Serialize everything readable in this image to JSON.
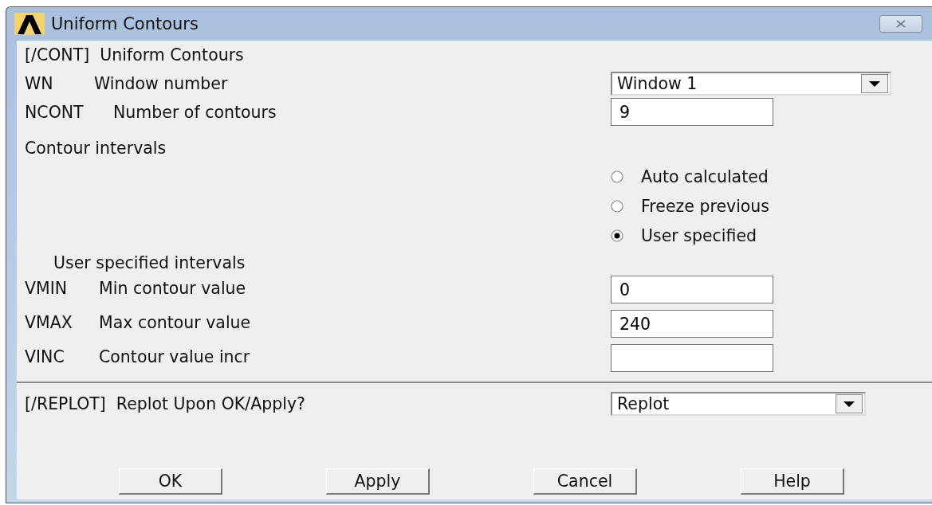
{
  "window": {
    "title": "Uniform Contours"
  },
  "heading": "[/CONT]  Uniform Contours",
  "window_number": {
    "code": "WN",
    "label": "Window number",
    "value": "Window 1"
  },
  "contours": {
    "code": "NCONT",
    "label": "Number of contours",
    "value": "9"
  },
  "intervals": {
    "label": "Contour intervals",
    "options": [
      {
        "label": "Auto calculated",
        "selected": false
      },
      {
        "label": "Freeze previous",
        "selected": false
      },
      {
        "label": "User specified",
        "selected": true
      }
    ]
  },
  "user_intervals": {
    "label": "User specified intervals",
    "fields": [
      {
        "code": "VMIN",
        "label": "Min contour value",
        "value": "0"
      },
      {
        "code": "VMAX",
        "label": "Max contour value",
        "value": "240"
      },
      {
        "code": "VINC",
        "label": "Contour value incr"
      }
    ]
  },
  "replot": {
    "label": "[/REPLOT]  Replot Upon OK/Apply?",
    "value": "Replot"
  },
  "buttons": [
    "OK",
    "Apply",
    "Cancel",
    "Help"
  ]
}
